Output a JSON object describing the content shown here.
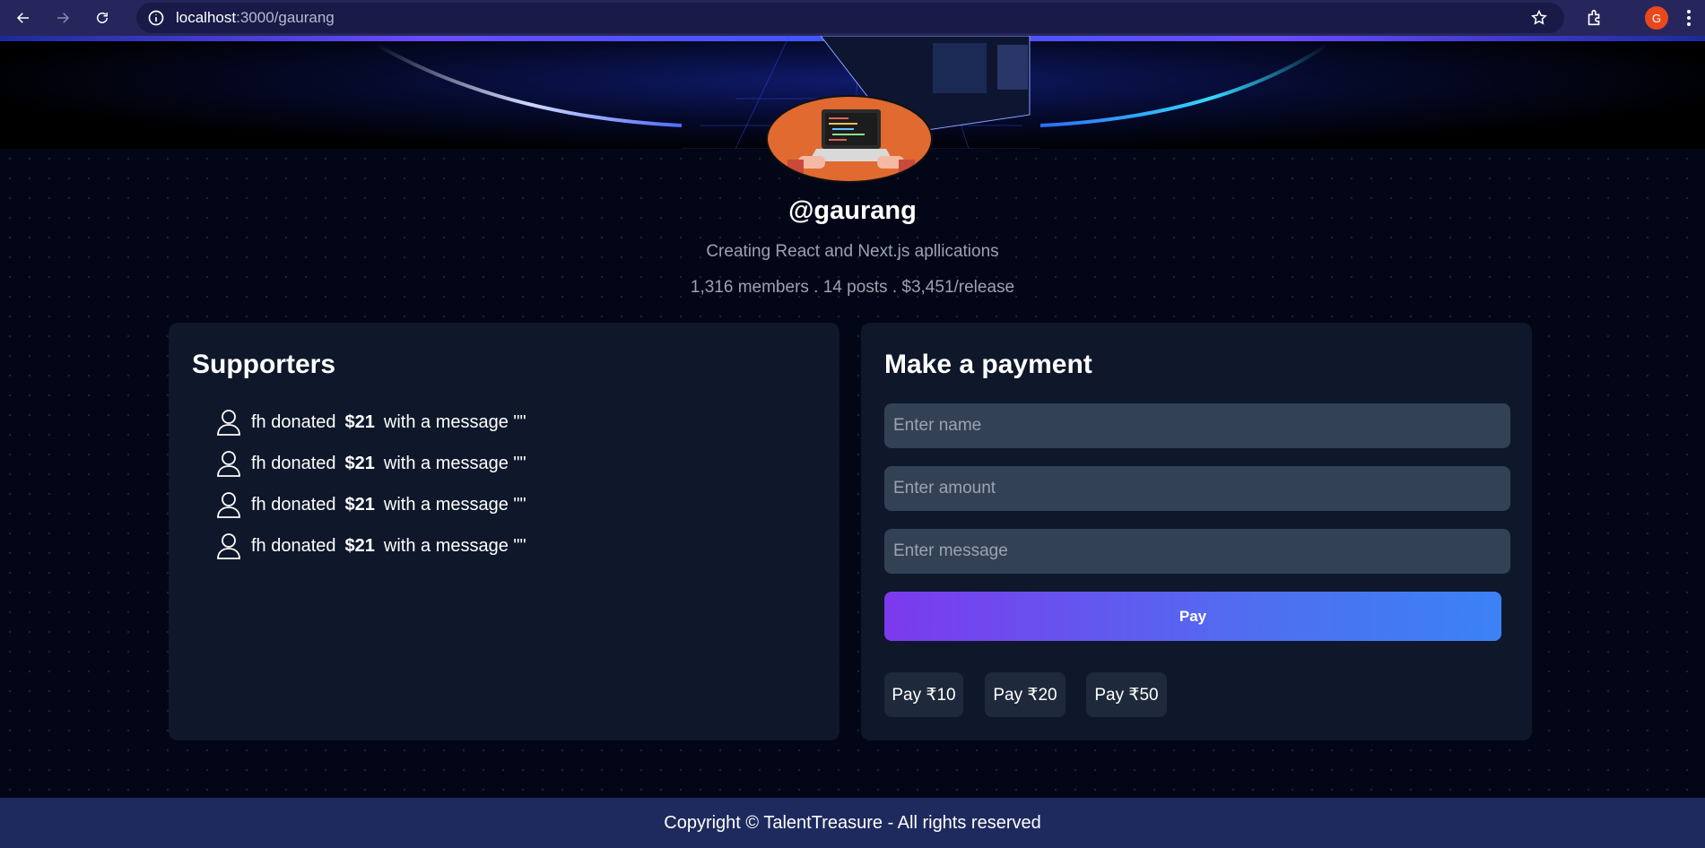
{
  "browser": {
    "url_host": "localhost",
    "url_path": ":3000/gaurang",
    "profile_initial": "G",
    "icons": [
      "back-arrow-icon",
      "forward-arrow-icon",
      "reload-icon",
      "info-icon",
      "star-icon",
      "extensions-icon",
      "menu-dots-icon"
    ]
  },
  "profile": {
    "handle": "@gaurang",
    "bio": "Creating React and Next.js apllications",
    "stats": "1,316 members . 14 posts . $3,451/release"
  },
  "supporters": {
    "title": "Supporters",
    "items": [
      {
        "name": "fh",
        "verb": "donated",
        "amount": "$21",
        "message_text": "with a message \"\""
      },
      {
        "name": "fh",
        "verb": "donated",
        "amount": "$21",
        "message_text": "with a message \"\""
      },
      {
        "name": "fh",
        "verb": "donated",
        "amount": "$21",
        "message_text": "with a message \"\""
      },
      {
        "name": "fh",
        "verb": "donated",
        "amount": "$21",
        "message_text": "with a message \"\""
      }
    ]
  },
  "payment": {
    "title": "Make a payment",
    "name_placeholder": "Enter name",
    "amount_placeholder": "Enter amount",
    "message_placeholder": "Enter message",
    "pay_label": "Pay",
    "quick": [
      "Pay ₹10",
      "Pay ₹20",
      "Pay ₹50"
    ]
  },
  "footer": {
    "text": "Copyright © TalentTreasure - All rights reserved"
  },
  "colors": {
    "background": "#020617",
    "card": "#0f172a",
    "input": "#334155",
    "pay_gradient_start": "#7c3aed",
    "pay_gradient_end": "#3b82f6",
    "footer": "#1e2a5e"
  }
}
